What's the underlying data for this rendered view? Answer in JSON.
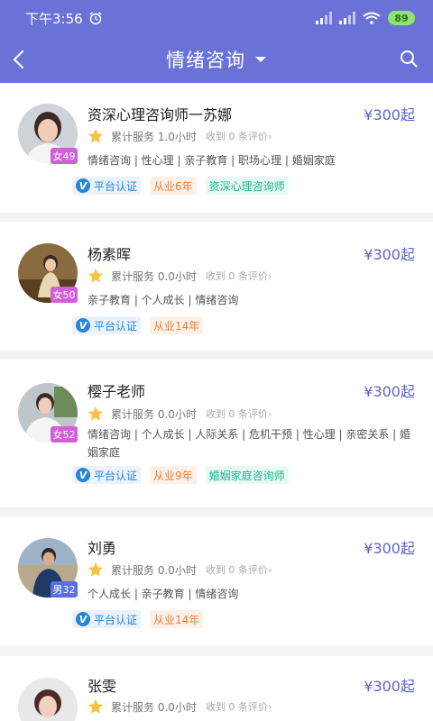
{
  "status": {
    "time": "下午3:56",
    "battery": "89"
  },
  "nav": {
    "title": "情绪咨询"
  },
  "labels": {
    "cert": "平台认证",
    "service_prefix": "累计服务",
    "reviews": "收到 0 条评价",
    "chevron": "›"
  },
  "colors": {
    "header": "#6a72d8",
    "price": "#5e63d1",
    "cert": "#2a84d6",
    "years": "#e8823f",
    "role": "#1fb58b"
  },
  "counselors": [
    {
      "name": "资深心理咨询师一苏娜",
      "price": "¥300起",
      "age": "女49",
      "gender": "female",
      "service": "1.0小时",
      "tags": "情绪咨询 | 性心理 | 亲子教育 | 职场心理 | 婚姻家庭",
      "years": "从业6年",
      "role": "资深心理咨询师"
    },
    {
      "name": "杨素晖",
      "price": "¥300起",
      "age": "女50",
      "gender": "female",
      "service": "0.0小时",
      "tags": "亲子教育 | 个人成长 | 情绪咨询",
      "years": "从业14年",
      "role": ""
    },
    {
      "name": "樱子老师",
      "price": "¥300起",
      "age": "女52",
      "gender": "female",
      "service": "0.0小时",
      "tags": "情绪咨询 | 个人成长 | 人际关系 | 危机干预 | 性心理 | 亲密关系 | 婚姻家庭",
      "years": "从业9年",
      "role": "婚姻家庭咨询师"
    },
    {
      "name": "刘勇",
      "price": "¥300起",
      "age": "男32",
      "gender": "male",
      "service": "0.0小时",
      "tags": "个人成长 | 亲子教育 | 情绪咨询",
      "years": "从业14年",
      "role": ""
    },
    {
      "name": "张雯",
      "price": "¥300起",
      "age": "",
      "gender": "female",
      "service": "0.0小时",
      "tags": "",
      "years": "",
      "role": ""
    }
  ]
}
